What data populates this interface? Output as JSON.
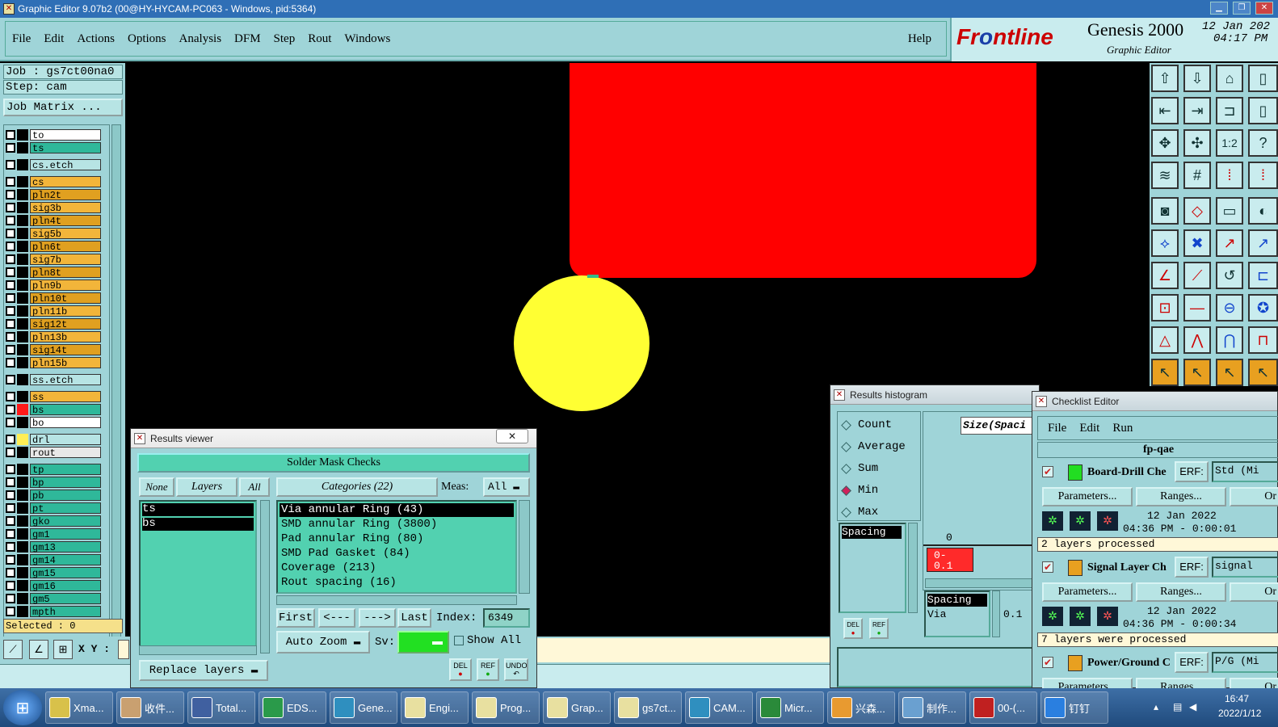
{
  "window": {
    "title": "Graphic Editor 9.07b2 (00@HY-HYCAM-PC063 - Windows, pid:5364)"
  },
  "menu": {
    "items": [
      "File",
      "Edit",
      "Actions",
      "Options",
      "Analysis",
      "DFM",
      "Step",
      "Rout",
      "Windows"
    ],
    "help": "Help"
  },
  "brand": {
    "logo_a": "Fr",
    "logo_b": "o",
    "logo_c": "ntline",
    "product": "Genesis 2000",
    "subtitle": "Graphic Editor",
    "date": "12 Jan 202",
    "time": "04:17 PM"
  },
  "left": {
    "job": "Job : gs7ct00na0",
    "step": "Step: cam",
    "job_matrix": "Job Matrix ...",
    "selected": "Selected : 0"
  },
  "layers": [
    {
      "name": "to",
      "color": "#ffffff"
    },
    {
      "name": "ts",
      "color": "#2fb89a"
    },
    {
      "name": "cs.etch",
      "color": "#b7e4e4"
    },
    {
      "name": "cs",
      "color": "#f2b53a"
    },
    {
      "name": "pln2t",
      "color": "#e0a020"
    },
    {
      "name": "sig3b",
      "color": "#f2b53a"
    },
    {
      "name": "pln4t",
      "color": "#e0a020"
    },
    {
      "name": "sig5b",
      "color": "#f2b53a"
    },
    {
      "name": "pln6t",
      "color": "#e0a020"
    },
    {
      "name": "sig7b",
      "color": "#f2b53a"
    },
    {
      "name": "pln8t",
      "color": "#e0a020"
    },
    {
      "name": "pln9b",
      "color": "#f2b53a"
    },
    {
      "name": "pln10t",
      "color": "#e0a020"
    },
    {
      "name": "pln11b",
      "color": "#f2b53a"
    },
    {
      "name": "sig12t",
      "color": "#e0a020"
    },
    {
      "name": "pln13b",
      "color": "#f2b53a"
    },
    {
      "name": "sig14t",
      "color": "#e0a020"
    },
    {
      "name": "pln15b",
      "color": "#f2b53a"
    },
    {
      "name": "ss.etch",
      "color": "#b7e4e4"
    },
    {
      "name": "ss",
      "color": "#f2b53a"
    },
    {
      "name": "bs",
      "color": "#2fb89a"
    },
    {
      "name": "bo",
      "color": "#ffffff"
    },
    {
      "name": "drl",
      "color": "#b7e4e4"
    },
    {
      "name": "rout",
      "color": "#e8e8e8"
    },
    {
      "name": "tp",
      "color": "#2fb89a"
    },
    {
      "name": "bp",
      "color": "#2fb89a"
    },
    {
      "name": "pb",
      "color": "#2fb89a"
    },
    {
      "name": "pt",
      "color": "#2fb89a"
    },
    {
      "name": "gko",
      "color": "#2fb89a"
    },
    {
      "name": "gm1",
      "color": "#2fb89a"
    },
    {
      "name": "gm13",
      "color": "#2fb89a"
    },
    {
      "name": "gm14",
      "color": "#2fb89a"
    },
    {
      "name": "gm15",
      "color": "#2fb89a"
    },
    {
      "name": "gm16",
      "color": "#2fb89a"
    },
    {
      "name": "gm5",
      "color": "#2fb89a"
    },
    {
      "name": "mpth",
      "color": "#2fb89a"
    }
  ],
  "toolbar": {
    "xy_label": "X Y :"
  },
  "results_viewer": {
    "title": "Results viewer",
    "header": "Solder Mask Checks",
    "none": "None",
    "layers": "Layers",
    "all": "All",
    "categories_label": "Categories (22)",
    "meas_label": "Meas:",
    "meas_value": "All",
    "layer_items": [
      "ts",
      "bs"
    ],
    "category_items": [
      "Via annular Ring (43)",
      "SMD annular Ring (3800)",
      "Pad annular Ring (80)",
      "SMD Pad Gasket (84)",
      "Coverage (213)",
      "Rout spacing (16)"
    ],
    "first": "First",
    "prev": "<---",
    "next": "--->",
    "last": "Last",
    "index_label": "Index:",
    "index_value": "6349",
    "auto_zoom": "Auto Zoom",
    "sv_label": "Sv:",
    "show_all": "Show All",
    "replace_layers": "Replace layers",
    "del": "DEL",
    "ref": "REF",
    "undo": "UNDO"
  },
  "histogram": {
    "title": "Results histogram",
    "options": [
      "Count",
      "Average",
      "Sum",
      "Min",
      "Max"
    ],
    "selected_option": "Min",
    "size_label": "Size(Spaci",
    "axis_zero": "0",
    "bin_label": "0-\n0.1",
    "list_top": "Spacing",
    "list_items": [
      "Spacing",
      "Via"
    ],
    "value": "0.1",
    "del": "DEL",
    "ref": "REF"
  },
  "checklist": {
    "title": "Checklist Editor",
    "menu": [
      "File",
      "Edit",
      "Run"
    ],
    "name": "fp-qae",
    "erf": "ERF:",
    "parameters": "Parameters...",
    "ranges": "Ranges...",
    "checks": [
      {
        "name": "Board-Drill Che",
        "erf_value": "Std (Mi",
        "date": "12 Jan 2022",
        "time": "04:36 PM - 0:00:01",
        "status": "2 layers processed"
      },
      {
        "name": "Signal Layer Ch",
        "erf_value": "signal",
        "date": "12 Jan 2022",
        "time": "04:36 PM - 0:00:34",
        "status": "7 layers were processed"
      },
      {
        "name": "Power/Ground C",
        "erf_value": "P/G (Mi",
        "date": "",
        "time": "",
        "status": ""
      }
    ],
    "cut_or": "Or"
  },
  "taskbar": {
    "items": [
      "Xma...",
      "收件...",
      "Total...",
      "EDS...",
      "Gene...",
      "Engi...",
      "Prog...",
      "Grap...",
      "gs7ct...",
      "CAM...",
      "Micr...",
      "兴森...",
      "制作...",
      "00-(...",
      "钉钉"
    ],
    "clock_time": "16:47",
    "clock_date": "2022/1/12"
  },
  "colors": {
    "bg": "#9fd4d8",
    "red_pad": "#ff0000",
    "yellow_pad": "#ffff33",
    "field": "#52d1b0"
  }
}
